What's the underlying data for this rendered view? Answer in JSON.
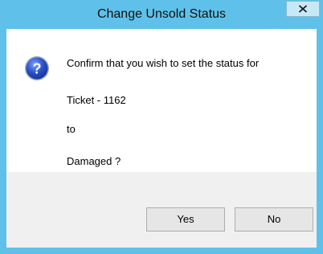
{
  "window": {
    "title": "Change Unsold Status",
    "close_icon": "close-icon",
    "border_color": "#5fc1ea"
  },
  "message": {
    "icon": "question-icon",
    "icon_color": "#2b53c6",
    "line1": "Confirm that you wish to set the status for",
    "line2": "Ticket - 1162",
    "line3": "to",
    "line4": "Damaged ?"
  },
  "buttons": {
    "yes_label": "Yes",
    "no_label": "No"
  }
}
